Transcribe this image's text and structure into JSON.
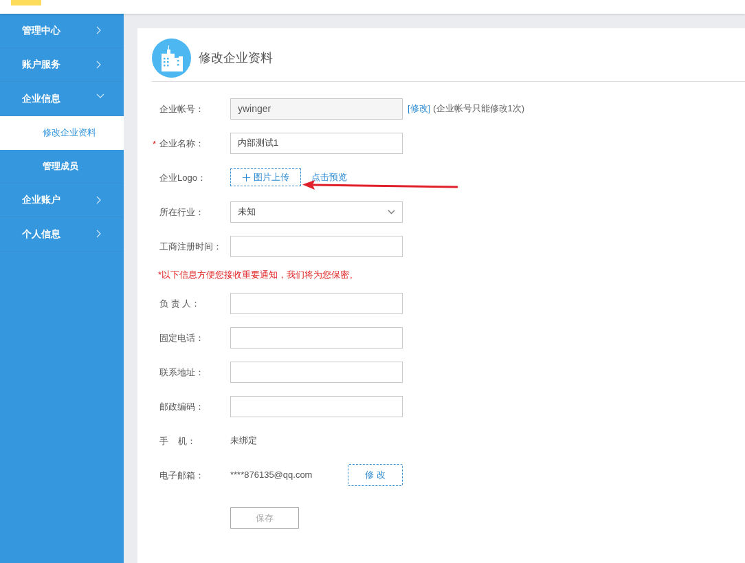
{
  "sidebar": {
    "items": [
      {
        "label": "管理中心",
        "expanded": false
      },
      {
        "label": "账户服务",
        "expanded": false
      },
      {
        "label": "企业信息",
        "expanded": true,
        "children": [
          {
            "label": "修改企业资料",
            "selected": true
          },
          {
            "label": "管理成员",
            "selected": false
          }
        ]
      },
      {
        "label": "企业账户",
        "expanded": false
      },
      {
        "label": "个人信息",
        "expanded": false
      }
    ]
  },
  "page": {
    "title": "修改企业资料"
  },
  "form": {
    "rows": [
      {
        "kind": "readonly",
        "label": "企业帐号：",
        "value": "ywinger",
        "link": "[修改]",
        "note": "(企业帐号只能修改1次)"
      },
      {
        "kind": "input",
        "label": "企业名称：",
        "value": "内部测试1",
        "mark": "*"
      },
      {
        "kind": "upload",
        "label": "企业Logo：",
        "button": "图片上传",
        "link": "点击预览"
      },
      {
        "kind": "select",
        "label": "所在行业：",
        "value": "未知"
      },
      {
        "kind": "input",
        "label": "工商注册时间："
      },
      {
        "kind": "notice",
        "text": "*以下信息方便您接收重要通知，我们将为您保密。"
      },
      {
        "kind": "input",
        "label": "负 责 人："
      },
      {
        "kind": "input",
        "label": "固定电话："
      },
      {
        "kind": "input",
        "label": "联系地址："
      },
      {
        "kind": "input",
        "label": "邮政编码："
      },
      {
        "kind": "text",
        "label": "手    机：",
        "value": "未绑定"
      },
      {
        "kind": "text",
        "label": "电子邮箱：",
        "value": "****876135@qq.com",
        "button": "修 改"
      }
    ],
    "save": {
      "label": "保存",
      "disabled": true
    }
  }
}
